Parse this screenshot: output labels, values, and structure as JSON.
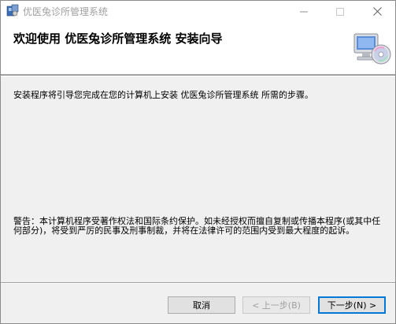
{
  "window": {
    "title": "优医兔诊所管理系统"
  },
  "header": {
    "title": "欢迎使用  优医兔诊所管理系统  安装向导"
  },
  "main": {
    "intro": "安装程序将引导您完成在您的计算机上安装 优医兔诊所管理系统 所需的步骤。",
    "warning": "警告：本计算机程序受著作权法和国际条约保护。如未经授权而擅自复制或传播本程序(或其中任何部分)，将受到严厉的民事及刑事制裁，并将在法律许可的范围内受到最大程度的起诉。"
  },
  "footer": {
    "cancel_label": "取消",
    "back_label": "< 上一步(B)",
    "next_label": "下一步(N) >"
  },
  "icons": {
    "app": "installer-icon",
    "header": "computer-cd-icon",
    "minimize": "minimize-icon",
    "maximize": "maximize-icon",
    "close": "close-icon"
  }
}
